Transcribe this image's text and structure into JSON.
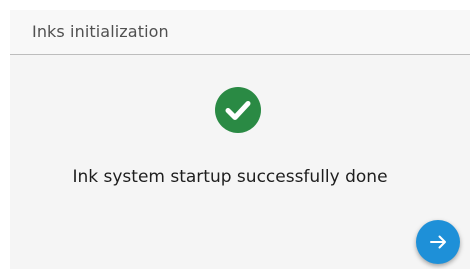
{
  "window": {
    "title": "Inks initialization"
  },
  "main": {
    "status_icon": "check-circle-icon",
    "status_color": "#2a8a44",
    "message": "Ink system startup successfully done"
  },
  "actions": {
    "next_icon": "arrow-right-icon",
    "next_color": "#1e90d8"
  }
}
